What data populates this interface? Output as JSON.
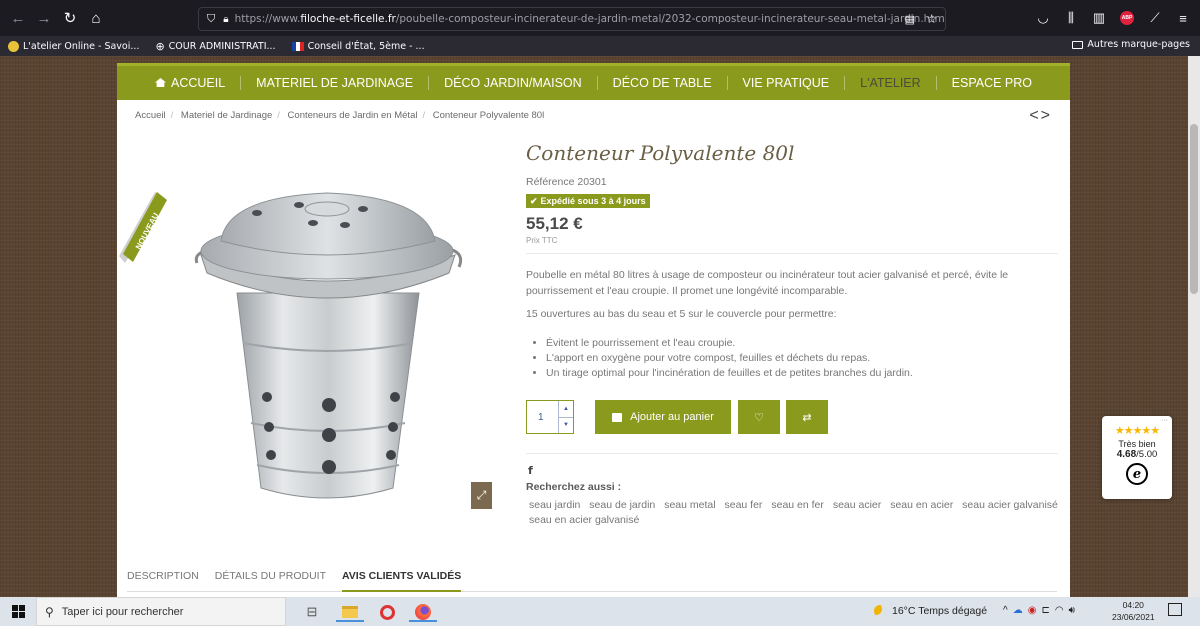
{
  "browser": {
    "url_prefix": "https://www.",
    "url_host": "filoche-et-ficelle.fr",
    "url_path": "/poubelle-composteur-incinerateur-de-jardin-metal/2032-composteur-incinerateur-seau-metal-jardin.html",
    "bookmarks": [
      "L'atelier Online - Savoi...",
      "COUR ADMINISTRATI...",
      "Conseil d'État, 5ème - ..."
    ],
    "other_bookmarks": "Autres marque-pages",
    "abp_label": "ABP"
  },
  "site": {
    "accent_color": "#8a9a1c",
    "nav": [
      "ACCUEIL",
      "MATERIEL DE JARDINAGE",
      "DÉCO JARDIN/MAISON",
      "DÉCO DE TABLE",
      "VIE PRATIQUE",
      "L'ATELIER",
      "ESPACE PRO"
    ],
    "breadcrumb": [
      "Accueil",
      "Materiel de Jardinage",
      "Conteneurs de Jardin en Métal",
      "Conteneur Polyvalente 80l"
    ],
    "pager": "<>"
  },
  "product": {
    "badge": "NOUVEAU",
    "title": "Conteneur Polyvalente 80l",
    "reference": "Référence 20301",
    "shipping": "Expédié sous 3 à 4 jours",
    "price": "55,12 €",
    "price_note": "Prix TTC",
    "description": "Poubelle en métal 80 litres à usage de composteur ou incinérateur tout acier galvanisé et percé, évite le pourrissement et l'eau croupie. Il promet une longévité incomparable.",
    "intro": "15 ouvertures au bas du seau et 5 sur le couvercle pour permettre:",
    "bullets": [
      "Évitent le pourrissement et l'eau croupie.",
      "L'apport en oxygène pour votre compost, feuilles et déchets du repas.",
      "Un tirage optimal pour l'incinération de feuilles et de petites branches du jardin."
    ],
    "quantity": "1",
    "add_to_cart": "Ajouter au panier",
    "facebook": "f",
    "search_label": "Recherchez aussi :",
    "tags": [
      "seau jardin",
      "seau de jardin",
      "seau metal",
      "seau fer",
      "seau en fer",
      "seau acier",
      "seau en acier",
      "seau acier galvanisé",
      "seau en acier galvanisé"
    ],
    "tabs": [
      "DESCRIPTION",
      "DÉTAILS DU PRODUIT",
      "AVIS CLIENTS VALIDÉS"
    ]
  },
  "trusted": {
    "stars": "★★★★★",
    "label": "Très bien",
    "score": "4.68",
    "max": "/5.00",
    "logo": "e",
    "more": "···"
  },
  "taskbar": {
    "search_placeholder": "Taper ici pour rechercher",
    "weather": "16°C  Temps dégagé",
    "time": "04:20",
    "date": "23/06/2021"
  }
}
